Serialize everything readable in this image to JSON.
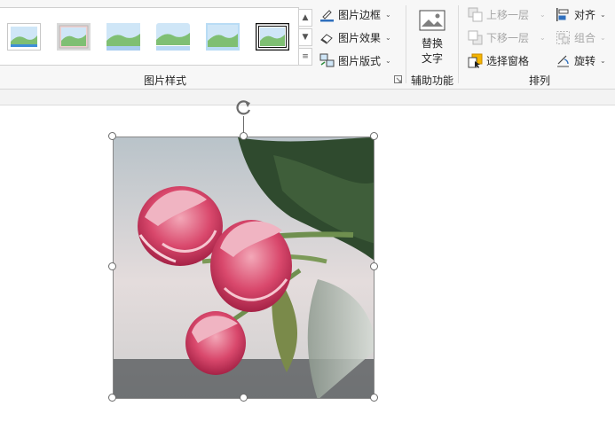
{
  "picture_styles": {
    "label": "图片样式",
    "thumbnails": [
      "simple-frame-white",
      "beveled-matte-white",
      "metal-frame",
      "reflected-rounded",
      "soft-edge",
      "double-frame-black"
    ]
  },
  "picture_commands": {
    "border": "图片边框",
    "effects": "图片效果",
    "layout": "图片版式"
  },
  "accessibility": {
    "alt_text_line1": "替换",
    "alt_text_line2": "文字",
    "label": "辅助功能"
  },
  "arrange": {
    "bring_forward": "上移一层",
    "send_backward": "下移一层",
    "selection_pane": "选择窗格",
    "align": "对齐",
    "group": "组合",
    "rotate": "旋转",
    "label": "排列"
  },
  "colors": {
    "accent": "#2f6fbd",
    "disabled_text": "#a6a6a6",
    "ribbon_bg": "#f7f7f7"
  },
  "image": {
    "subject": "pink tulips in vase photo",
    "selected": true
  }
}
